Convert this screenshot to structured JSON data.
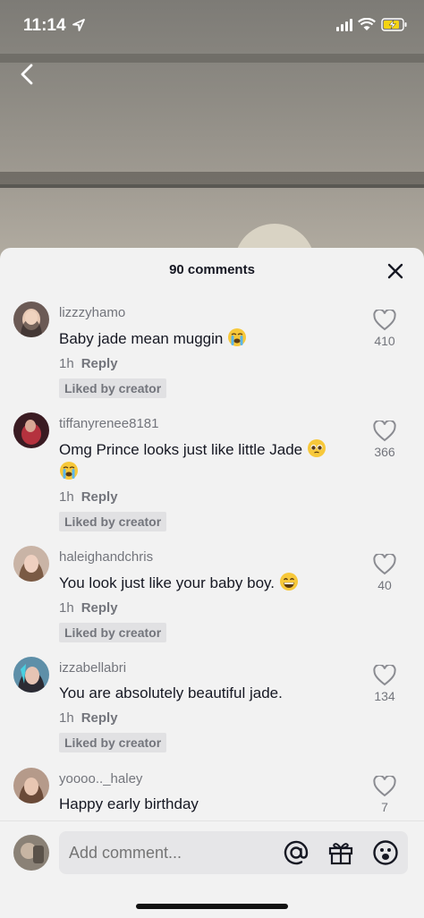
{
  "status_bar": {
    "time": "11:14"
  },
  "sheet": {
    "title": "90 comments"
  },
  "comments": [
    {
      "username": "lizzzyhamo",
      "text": "Baby jade mean muggin",
      "emoji": "loudly-crying-face",
      "time": "1h",
      "reply": "Reply",
      "liked_badge": "Liked by creator",
      "likes": "410"
    },
    {
      "username": "tiffanyrenee8181",
      "text": "Omg Prince looks just like little Jade",
      "emoji": "pleading-face",
      "emoji2": "loudly-crying-face",
      "time": "1h",
      "reply": "Reply",
      "liked_badge": "Liked by creator",
      "likes": "366"
    },
    {
      "username": "haleighandchris",
      "text": "You look just like your baby boy.",
      "emoji": "grinning-face",
      "time": "1h",
      "reply": "Reply",
      "liked_badge": "Liked by creator",
      "likes": "40"
    },
    {
      "username": "izzabellabri",
      "text": "You are absolutely beautiful jade.",
      "time": "1h",
      "reply": "Reply",
      "liked_badge": "Liked by creator",
      "likes": "134"
    },
    {
      "username": "yoooo.._haley",
      "text": "Happy early birthday",
      "likes": "7"
    }
  ],
  "composer": {
    "placeholder": "Add comment..."
  },
  "icons": {
    "back": "chevron-left-icon",
    "close": "close-icon",
    "heart": "heart-outline-icon",
    "mention": "at-sign-icon",
    "gift": "gift-icon",
    "emoji": "smiley-icon"
  },
  "colors": {
    "text": "#161823",
    "muted": "#73757c",
    "sheet": "#f2f2f2",
    "badge": "#e1e1e3"
  }
}
